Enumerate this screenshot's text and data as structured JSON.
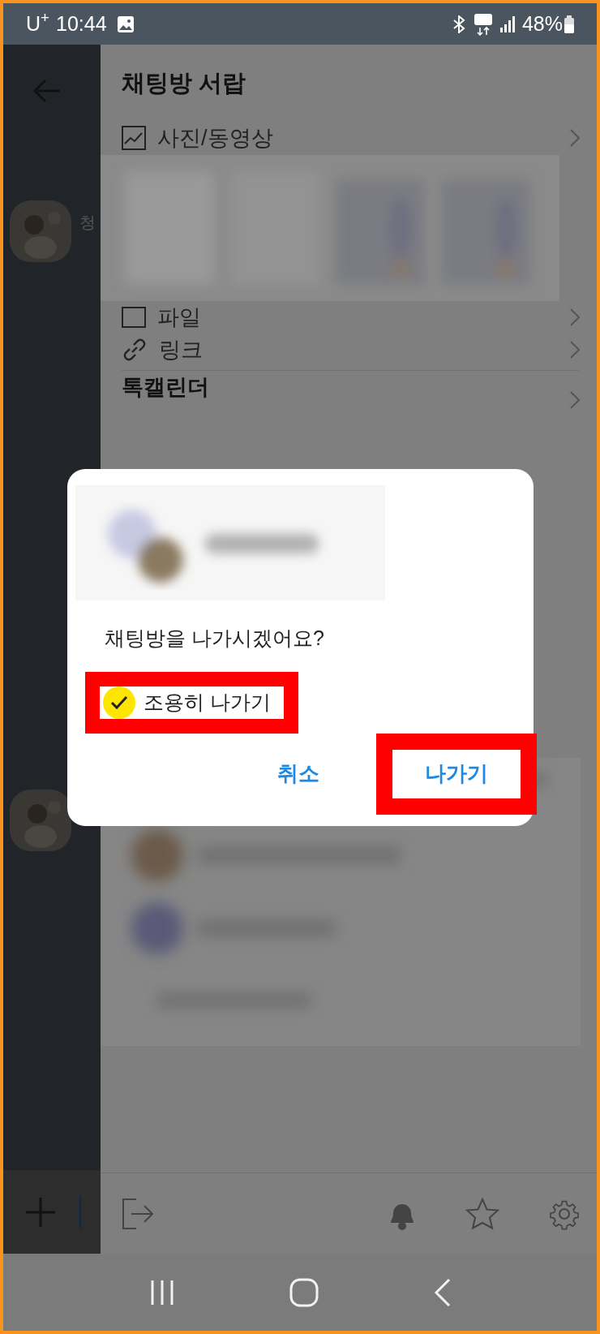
{
  "status_bar": {
    "carrier": "U$^{+}$",
    "time": "10:44",
    "battery": "48%"
  },
  "chat": {
    "sender_name": "청"
  },
  "drawer": {
    "title": "채팅방 서랍",
    "items": [
      {
        "label": "사진/동영상"
      },
      {
        "label": "파일",
        "kind": "file"
      },
      {
        "label": "링크",
        "kind": "link"
      }
    ],
    "calendar": {
      "label": "톡캘린더"
    }
  },
  "dialog": {
    "question": "채팅방을 나가시겠어요?",
    "quiet_exit": {
      "label": "조용히 나가기",
      "checked": true,
      "highlighted": true
    },
    "buttons": [
      {
        "label": "취소",
        "highlighted": false
      },
      {
        "label": "나가기",
        "highlighted": true
      }
    ]
  }
}
